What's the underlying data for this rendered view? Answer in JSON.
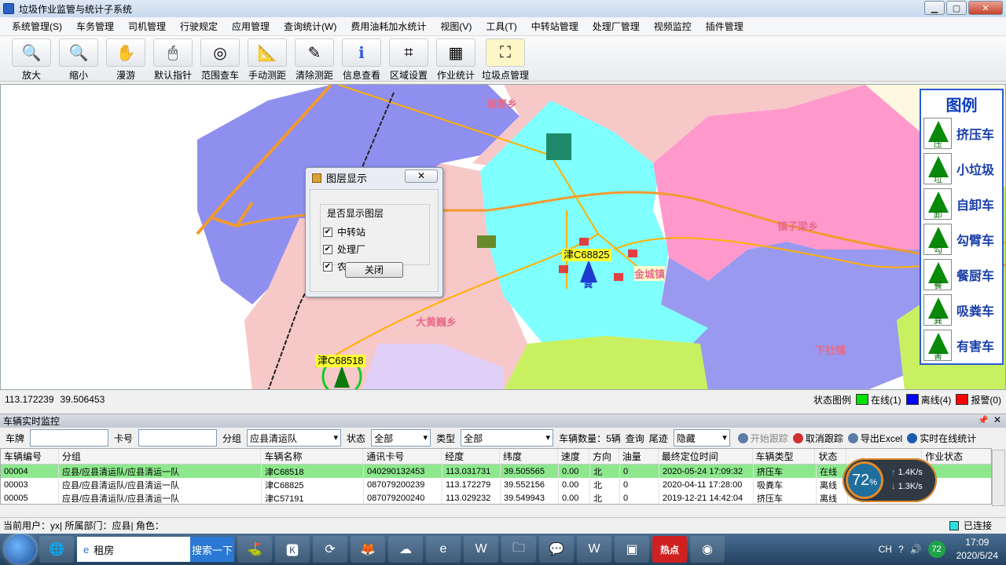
{
  "window": {
    "title": "垃圾作业监管与统计子系统",
    "min": "▁",
    "max": "▢",
    "close": "✕"
  },
  "menu": [
    "系统管理(S)",
    "车务管理",
    "司机管理",
    "行驶规定",
    "应用管理",
    "查询统计(W)",
    "费用油耗加水统计",
    "视图(V)",
    "工具(T)",
    "中转站管理",
    "处理厂管理",
    "视频监控",
    "插件管理"
  ],
  "toolbar": [
    {
      "label": "放大",
      "icon": "zoom-in-icon",
      "glyph": "🔍"
    },
    {
      "label": "缩小",
      "icon": "zoom-out-icon",
      "glyph": "🔍"
    },
    {
      "label": "漫游",
      "icon": "pan-hand-icon",
      "glyph": "✋"
    },
    {
      "label": "默认指针",
      "icon": "pointer-icon",
      "glyph": "🖱"
    },
    {
      "label": "范围查车",
      "icon": "range-search-icon",
      "glyph": "◎"
    },
    {
      "label": "手动测距",
      "icon": "measure-icon",
      "glyph": "📐"
    },
    {
      "label": "清除测距",
      "icon": "clear-measure-icon",
      "glyph": "✎"
    },
    {
      "label": "信息查看",
      "icon": "info-icon",
      "glyph": "ℹ"
    },
    {
      "label": "区域设置",
      "icon": "area-settings-icon",
      "glyph": "⌗"
    },
    {
      "label": "作业统计",
      "icon": "statistics-icon",
      "glyph": "▦"
    },
    {
      "label": "垃圾点管理",
      "icon": "garbage-point-icon",
      "glyph": "⛶"
    }
  ],
  "map": {
    "places": [
      "碱寨乡",
      "镇子梁乡",
      "金城镇",
      "大黄巍乡",
      "下社镇"
    ],
    "plates": [
      "津C68825",
      "津C68518"
    ],
    "vehicle_marker_label": "粪"
  },
  "legend": {
    "title": "图例",
    "items": [
      {
        "badge": "压",
        "name": "挤压车"
      },
      {
        "badge": "垃",
        "name": "小垃圾"
      },
      {
        "badge": "卸",
        "name": "自卸车"
      },
      {
        "badge": "勾",
        "name": "勾臂车"
      },
      {
        "badge": "餐",
        "name": "餐厨车"
      },
      {
        "badge": "粪",
        "name": "吸粪车"
      },
      {
        "badge": "害",
        "name": "有害车"
      }
    ]
  },
  "layer_dialog": {
    "title": "图层显示",
    "close": "✕",
    "group_label": "是否显示图层",
    "options": [
      {
        "label": "中转站",
        "checked": true
      },
      {
        "label": "处理厂",
        "checked": true
      },
      {
        "label": "农村垃圾点",
        "checked": true
      }
    ],
    "close_button": "关闭"
  },
  "coords": {
    "lon": "113.172239",
    "lat": "39.506453"
  },
  "status_legend": {
    "label": "状态图例",
    "items": [
      {
        "label": "在线(1)",
        "color": "#00e000"
      },
      {
        "label": "离线(4)",
        "color": "#0000ff"
      },
      {
        "label": "报警(0)",
        "color": "#ff0000"
      }
    ]
  },
  "monitor": {
    "title": "车辆实时监控",
    "pin": "📌",
    "close": "✕",
    "filters": {
      "plate_label": "车牌",
      "card_label": "卡号",
      "group_label": "分组",
      "group_value": "应县清运队",
      "status_label": "状态",
      "status_value": "全部",
      "type_label": "类型",
      "type_value": "全部",
      "count_text": "车辆数量：5辆",
      "query": "查询",
      "trail_label": "尾迹",
      "trail_value": "隐藏",
      "start_track": "开始跟踪",
      "cancel_track": "取消跟踪",
      "export": "导出Excel",
      "online_stats": "实时在线统计"
    },
    "columns": [
      "车辆编号",
      "分组",
      "车辆名称",
      "通讯卡号",
      "经度",
      "纬度",
      "速度",
      "方向",
      "油量",
      "最终定位时间",
      "车辆类型",
      "状态",
      "",
      "作业状态"
    ],
    "rows": [
      [
        "00004",
        "应县/应县清运队/应县清运一队",
        "津C68518",
        "040290132453",
        "113.031731",
        "39.505565",
        "0.00",
        "北",
        "0",
        "2020-05-24 17:09:32",
        "挤压车",
        "在线",
        "",
        ""
      ],
      [
        "00003",
        "应县/应县清运队/应县清运一队",
        "津C68825",
        "087079200239",
        "113.172279",
        "39.552156",
        "0.00",
        "北",
        "0",
        "2020-04-11 17:28:00",
        "吸粪车",
        "离线",
        "",
        ""
      ],
      [
        "00005",
        "应县/应县清运队/应县清运一队",
        "津C57191",
        "087079200240",
        "113.029232",
        "39.549943",
        "0.00",
        "北",
        "0",
        "2019-12-21 14:42:04",
        "挤压车",
        "离线",
        "",
        ""
      ]
    ]
  },
  "network": {
    "percent": "72",
    "unit": "%",
    "up": "1.4K/s",
    "down": "1.3K/s"
  },
  "statusbar": {
    "user_text": "当前用户：yx| 所属部门：应县| 角色：",
    "connection": "已连接"
  },
  "taskbar": {
    "search_text": "租房",
    "search_button": "搜索一下",
    "apps": [
      "🌐",
      "⛳",
      "🅺",
      "⟳",
      "🦊",
      "☁",
      "e",
      "W",
      "🗀",
      "💬",
      "W",
      "▣",
      "热点",
      "◉"
    ],
    "tray": {
      "ime": "CH",
      "badge": "72",
      "time": "17:09",
      "date": "2020/5/24"
    }
  }
}
